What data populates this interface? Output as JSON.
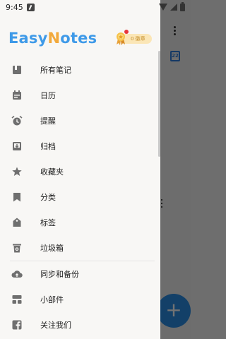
{
  "status_bar": {
    "time": "9:45"
  },
  "app": {
    "logo_prefix": "Easy",
    "logo_n": "N",
    "logo_suffix": "otes",
    "medal_text": "0 徽章"
  },
  "background": {
    "calendar_day": "22",
    "fab_label": "+"
  },
  "menu": {
    "items": [
      {
        "label": "所有笔记",
        "icon": "notes-icon"
      },
      {
        "label": "日历",
        "icon": "calendar-icon"
      },
      {
        "label": "提醒",
        "icon": "alarm-icon"
      },
      {
        "label": "归档",
        "icon": "archive-icon"
      },
      {
        "label": "收藏夹",
        "icon": "star-icon"
      },
      {
        "label": "分类",
        "icon": "bookmark-icon"
      },
      {
        "label": "标签",
        "icon": "tag-icon"
      },
      {
        "label": "垃圾箱",
        "icon": "trash-icon"
      },
      {
        "label": "同步和备份",
        "icon": "cloud-upload-icon"
      },
      {
        "label": "小部件",
        "icon": "widgets-icon"
      },
      {
        "label": "关注我们",
        "icon": "facebook-icon"
      }
    ]
  },
  "colors": {
    "accent": "#3f9ae8",
    "logo_n": "#f2a93b",
    "icon": "#6f6f6f",
    "fab": "#2a8ee6"
  }
}
